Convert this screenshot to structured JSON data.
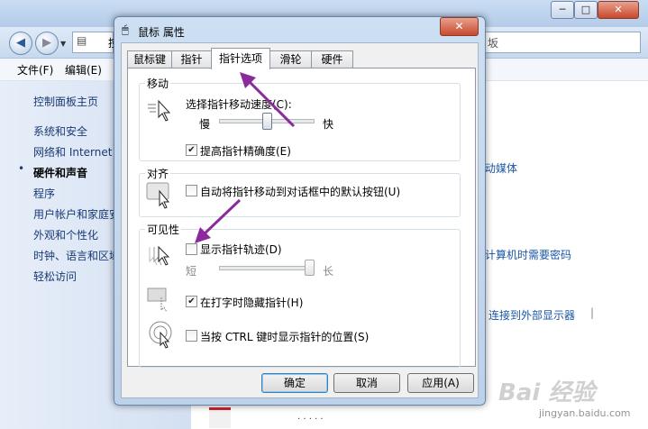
{
  "background": {
    "window_controls": {
      "minimize": "─",
      "maximize": "□",
      "close": "✕"
    },
    "address_text": "控",
    "search_text": "坂",
    "menu": {
      "file": "文件(F)",
      "edit": "编辑(E)"
    },
    "sidebar": {
      "home": "控制面板主页",
      "items": [
        "系统和安全",
        "网络和 Internet",
        "硬件和声音",
        "程序",
        "用户帐户和家庭安",
        "外观和个性化",
        "时钟、语言和区域",
        "轻松访问"
      ],
      "selected_index": 2,
      "bullet": "•"
    },
    "main_links": [
      "动媒体",
      "计算机时需要密码",
      "连接到外部显示器"
    ],
    "main_separator": "|",
    "bottom_text": "· · · · ·"
  },
  "dialog": {
    "title": "鼠标 属性",
    "close": "✕",
    "tabs": [
      "鼠标键",
      "指针",
      "指针选项",
      "滑轮",
      "硬件"
    ],
    "active_tab": 2,
    "motion": {
      "group": "移动",
      "speed_label": "选择指针移动速度(C):",
      "slow": "慢",
      "fast": "快",
      "speed_fraction": 0.5,
      "precision_label": "提高指针精确度(E)",
      "precision_checked": true
    },
    "snap": {
      "group": "对齐",
      "label": "自动将指针移动到对话框中的默认按钮(U)",
      "checked": false
    },
    "visibility": {
      "group": "可见性",
      "trails_label": "显示指针轨迹(D)",
      "trails_checked": false,
      "short": "短",
      "long": "长",
      "trail_fraction": 1.0,
      "hide_label": "在打字时隐藏指针(H)",
      "hide_checked": true,
      "ctrl_label": "当按 CTRL 键时显示指针的位置(S)",
      "ctrl_checked": false
    },
    "buttons": {
      "ok": "确定",
      "cancel": "取消",
      "apply": "应用(A)"
    }
  },
  "annotation_color": "#8b2a9c",
  "watermark": {
    "main": "Bai 经验",
    "sub": "jingyan.baidu.com"
  }
}
